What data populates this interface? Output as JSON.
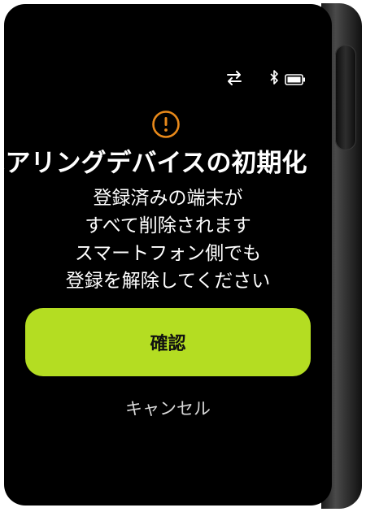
{
  "status": {
    "icons": [
      "sync-arrows-icon",
      "bluetooth-icon",
      "battery-icon"
    ]
  },
  "dialog": {
    "icon": "warning-icon",
    "icon_color": "#e8891a",
    "title": "ペアリングデバイスの初期化",
    "message_lines": [
      "登録済みの端末が",
      "すべて削除されます",
      "スマートフォン側でも",
      "登録を解除してください"
    ],
    "confirm_label": "確認",
    "cancel_label": "キャンセル"
  },
  "colors": {
    "accent": "#b4dd22",
    "screen_bg": "#000000",
    "text": "#ffffff"
  }
}
